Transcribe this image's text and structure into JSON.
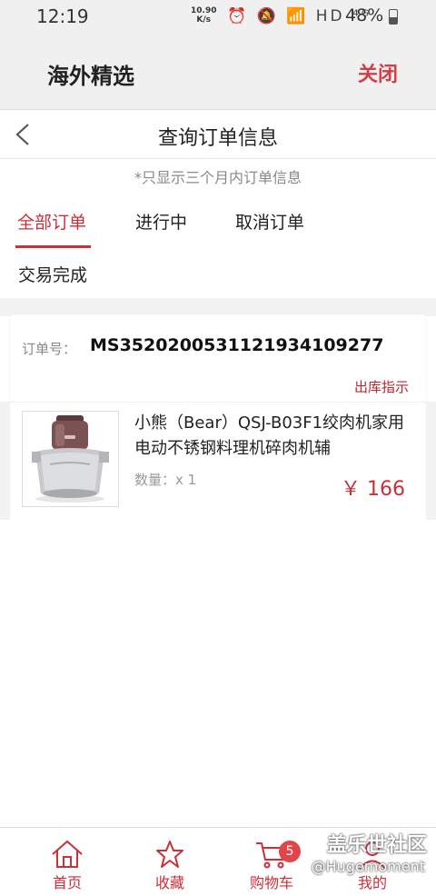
{
  "status": {
    "time": "12:19",
    "speed_value": "10.90",
    "speed_unit": "K/s",
    "icons": "⏰ 🔕 📶 HD ⁴ᴳ",
    "battery": "48%",
    "battery_level": 0.48
  },
  "header": {
    "title": "海外精选",
    "close_label": "关闭"
  },
  "nav": {
    "title": "查询订单信息"
  },
  "notice": "*只显示三个月内订单信息",
  "tabs": [
    {
      "label": "全部订单",
      "active": true
    },
    {
      "label": "进行中",
      "active": false
    },
    {
      "label": "取消订单",
      "active": false
    },
    {
      "label": "交易完成",
      "active": false
    }
  ],
  "order": {
    "number_label": "订单号：",
    "number": "MS352020053112193410927​7",
    "delivery_label": "出库指示",
    "product": {
      "name": "小熊（Bear）QSJ-B03F1绞肉机家用电动不锈钢料理机碎肉机辅",
      "quantity": "数量：x 1",
      "price": "￥ 166"
    }
  },
  "bottom_nav": [
    {
      "label": "首页",
      "icon": "home-icon"
    },
    {
      "label": "收藏",
      "icon": "star-icon"
    },
    {
      "label": "购物车",
      "icon": "cart-icon",
      "badge": "5"
    },
    {
      "label": "我的",
      "icon": "user-icon"
    }
  ],
  "watermark": {
    "line1": "盖乐世社区",
    "line2": "@Hugemoment"
  },
  "colors": {
    "accent": "#c8303a",
    "header_bg": "#f0f0f0"
  }
}
